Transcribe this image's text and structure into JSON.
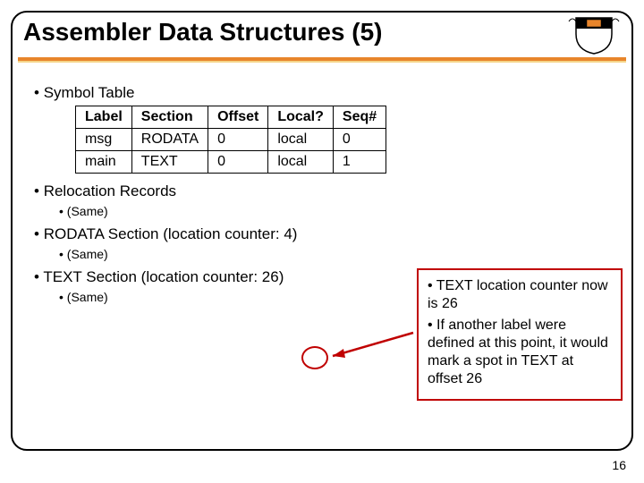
{
  "title": "Assembler Data Structures (5)",
  "bullets": {
    "symtable": "Symbol Table",
    "reloc": "Relocation Records",
    "same": "(Same)",
    "rodata": "RODATA Section (location counter: 4)",
    "text": "TEXT Section (location counter: 26)"
  },
  "table": {
    "headers": {
      "c0": "Label",
      "c1": "Section",
      "c2": "Offset",
      "c3": "Local?",
      "c4": "Seq#"
    },
    "rows": [
      {
        "c0": "msg",
        "c1": "RODATA",
        "c2": "0",
        "c3": "local",
        "c4": "0"
      },
      {
        "c0": "main",
        "c1": "TEXT",
        "c2": "0",
        "c3": "local",
        "c4": "1"
      }
    ]
  },
  "callout": {
    "l1": "TEXT location counter now is 26",
    "l2": "If another label were defined at this point, it would mark a spot in TEXT at offset 26"
  },
  "pagenum": "16"
}
